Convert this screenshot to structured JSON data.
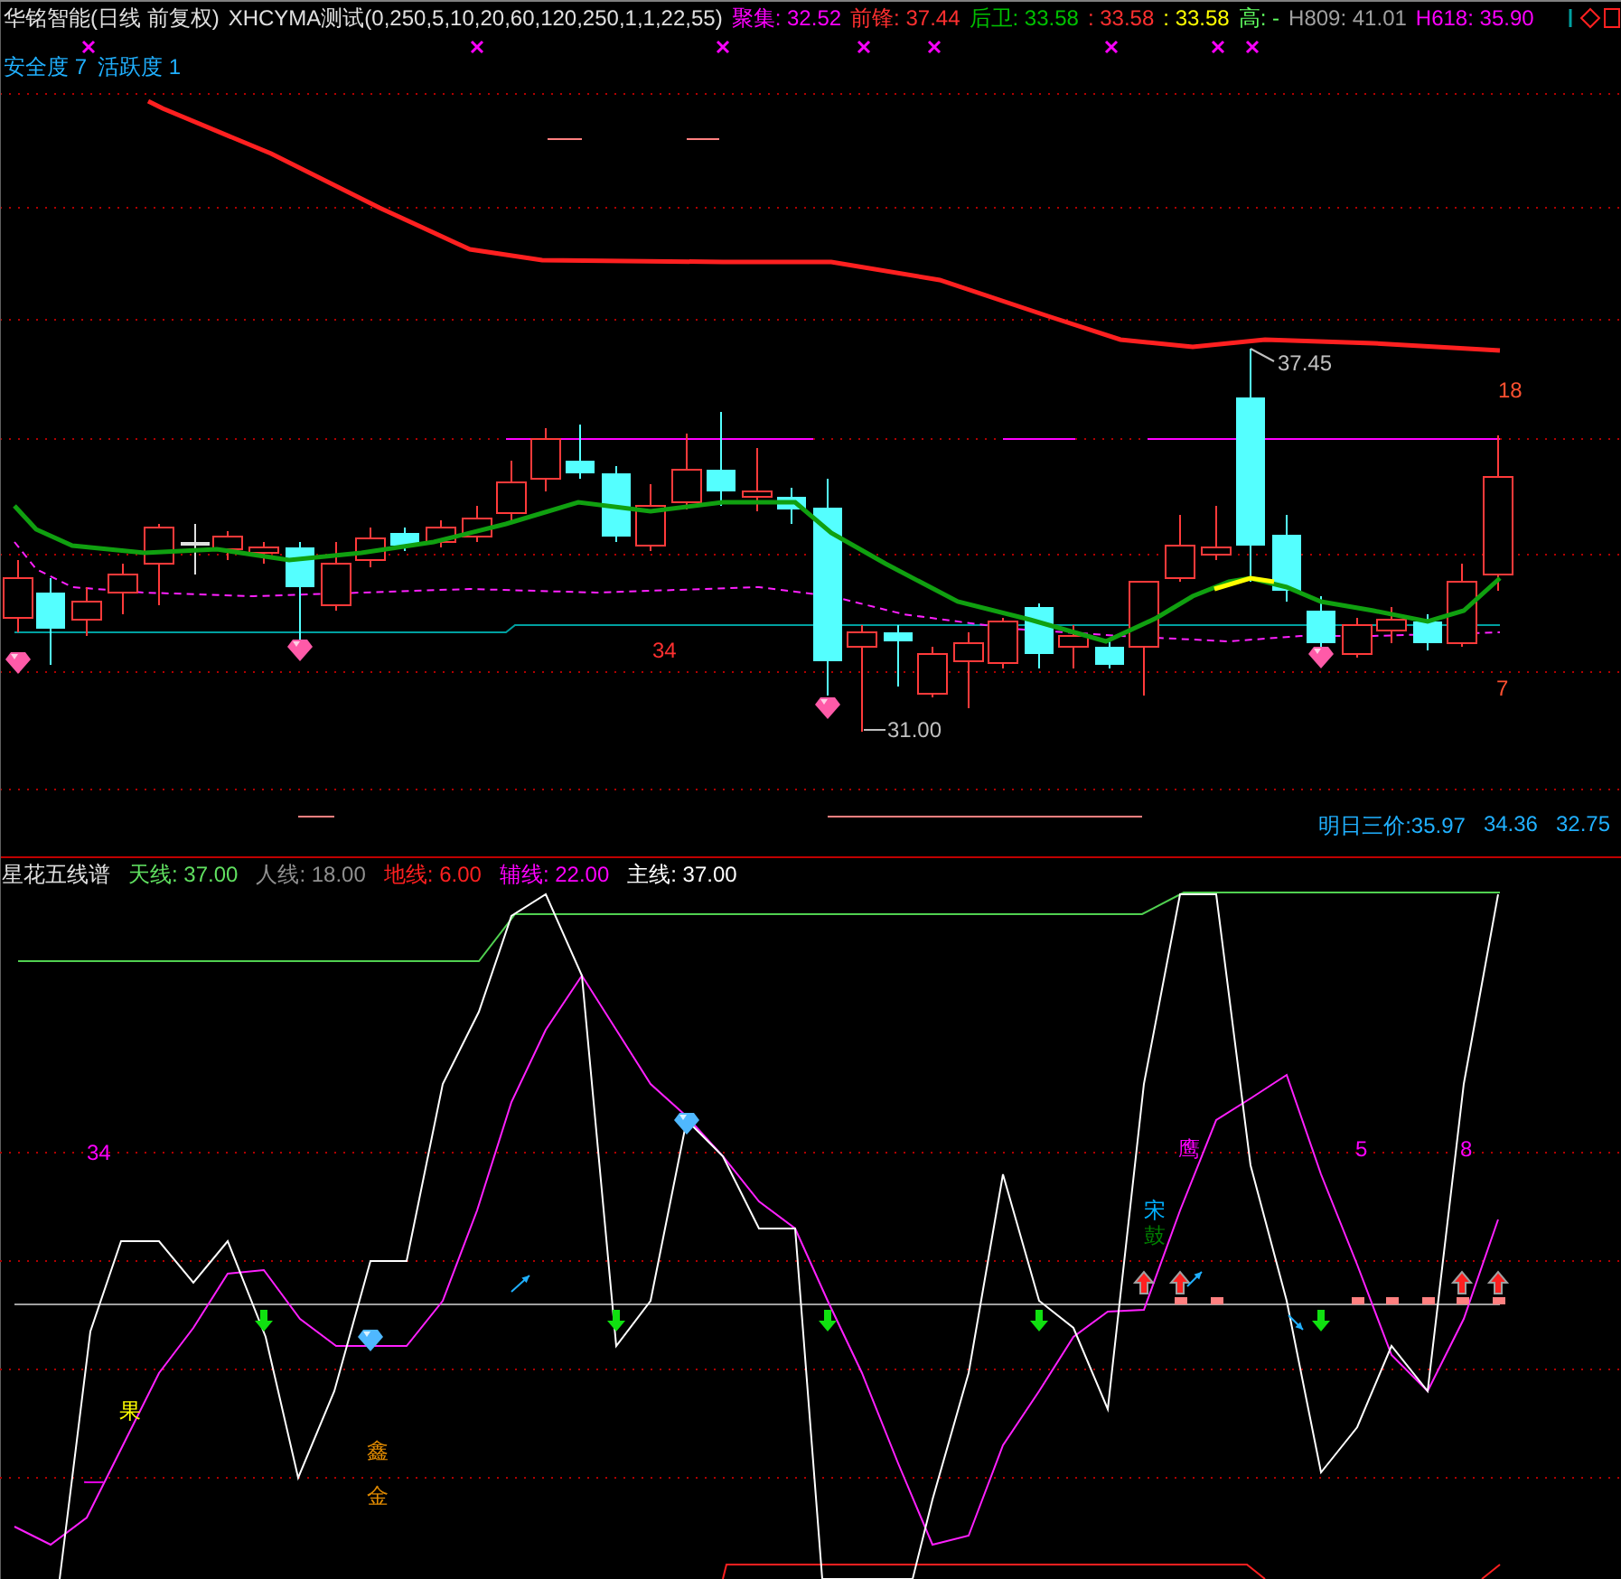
{
  "price_chart": {
    "header": {
      "title": "华铭智能(日线 前复权)",
      "indicator": "XHCYMA测试(0,250,5,10,20,60,120,250,1,1,22,55)",
      "values": [
        {
          "label": "聚集:",
          "value": "32.52",
          "color": "#ff00ff"
        },
        {
          "label": "前锋:",
          "value": "37.44",
          "color": "#ff3030"
        },
        {
          "label": "后卫:",
          "value": "33.58",
          "color": "#00c000"
        },
        {
          "label": ":",
          "value": "33.58",
          "color": "#ff3030"
        },
        {
          "label": ":",
          "value": "33.58",
          "color": "#ffff00"
        },
        {
          "label": "高:",
          "value": "-",
          "color": "#60ff60"
        },
        {
          "label": "H809:",
          "value": "41.01",
          "color": "#a0a0a0"
        },
        {
          "label": "H618:",
          "value": "35.90",
          "color": "#ff00ff"
        }
      ]
    },
    "stats": [
      {
        "label": "安全度",
        "value": "7"
      },
      {
        "label": "活跃度",
        "value": "1"
      }
    ],
    "annotations": [
      {
        "text": "37.45",
        "color": "#c0c0c0"
      },
      {
        "text": "31.00",
        "color": "#c0c0c0"
      },
      {
        "text": "18",
        "color": "#ff5030"
      },
      {
        "text": "7",
        "color": "#ff5030"
      },
      {
        "text": "34",
        "color": "#ff3030"
      }
    ],
    "forecast": {
      "label": "明日三价:",
      "values": [
        "35.97",
        "34.36",
        "32.75"
      ]
    }
  },
  "indicator_chart": {
    "title": "星花五线谱",
    "values": [
      {
        "label": "天线:",
        "value": "37.00",
        "color": "#60e060"
      },
      {
        "label": "人线:",
        "value": "18.00",
        "color": "#909090"
      },
      {
        "label": "地线:",
        "value": "6.00",
        "color": "#ff2020"
      },
      {
        "label": "辅线:",
        "value": "22.00",
        "color": "#ff00ff"
      },
      {
        "label": "主线:",
        "value": "37.00",
        "color": "#ffffff"
      }
    ],
    "annotations": [
      {
        "text": "34",
        "color": "#ff00ff"
      },
      {
        "text": "果",
        "color": "#ffff00"
      },
      {
        "text": "一",
        "color": "#ff00ff"
      },
      {
        "text": "鑫",
        "color": "#e08a00"
      },
      {
        "text": "金",
        "color": "#e08a00"
      },
      {
        "text": "宋",
        "color": "#00b0ff"
      },
      {
        "text": "鼓",
        "color": "#008000"
      },
      {
        "text": "鹰",
        "color": "#ff00ff"
      },
      {
        "text": "5",
        "color": "#ff00ff"
      },
      {
        "text": "8",
        "color": "#ff00ff"
      }
    ]
  }
}
